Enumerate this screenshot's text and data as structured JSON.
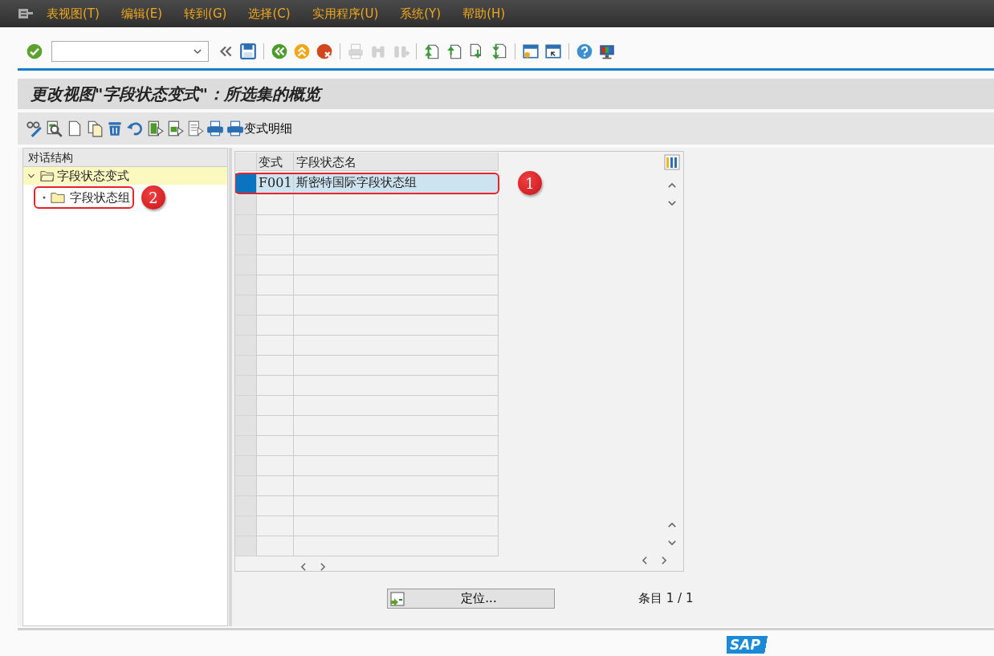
{
  "menu": [
    {
      "label": "表视图(T)"
    },
    {
      "label": "编辑(E)"
    },
    {
      "label": "转到(G)"
    },
    {
      "label": "选择(C)"
    },
    {
      "label": "实用程序(U)"
    },
    {
      "label": "系统(Y)"
    },
    {
      "label": "帮助(H)"
    }
  ],
  "toolbar": {
    "buttons": [
      {
        "disabled": false
      },
      {
        "disabled": false
      },
      {
        "disabled": false
      },
      {
        "disabled": false
      },
      {
        "disabled": false
      },
      {
        "disabled": false
      },
      {
        "disabled": true
      },
      {
        "disabled": true
      },
      {
        "disabled": true
      },
      {
        "disabled": false
      },
      {
        "disabled": false
      },
      {
        "disabled": false
      },
      {
        "disabled": false
      },
      {
        "disabled": false
      },
      {
        "disabled": false
      },
      {
        "disabled": false
      },
      {
        "disabled": false
      }
    ]
  },
  "title": "更改视图\"字段状态变式\"：所选集的概览",
  "app_toolbar": {
    "detail_button": "变式明细"
  },
  "tree": {
    "header": "对话结构",
    "items": [
      {
        "label": "字段状态变式",
        "expanded": true,
        "selected": true,
        "children": [
          {
            "label": "字段状态组",
            "selected": false,
            "callout": "2"
          }
        ]
      }
    ]
  },
  "table": {
    "columns": [
      "变式",
      "字段状态名"
    ],
    "rows": [
      {
        "variant": "F001",
        "name": "斯密特国际字段状态组",
        "selected": true,
        "callout": "1"
      }
    ]
  },
  "position_button": "定位...",
  "entry_count": "条目 1 / 1",
  "logo": "SAP"
}
